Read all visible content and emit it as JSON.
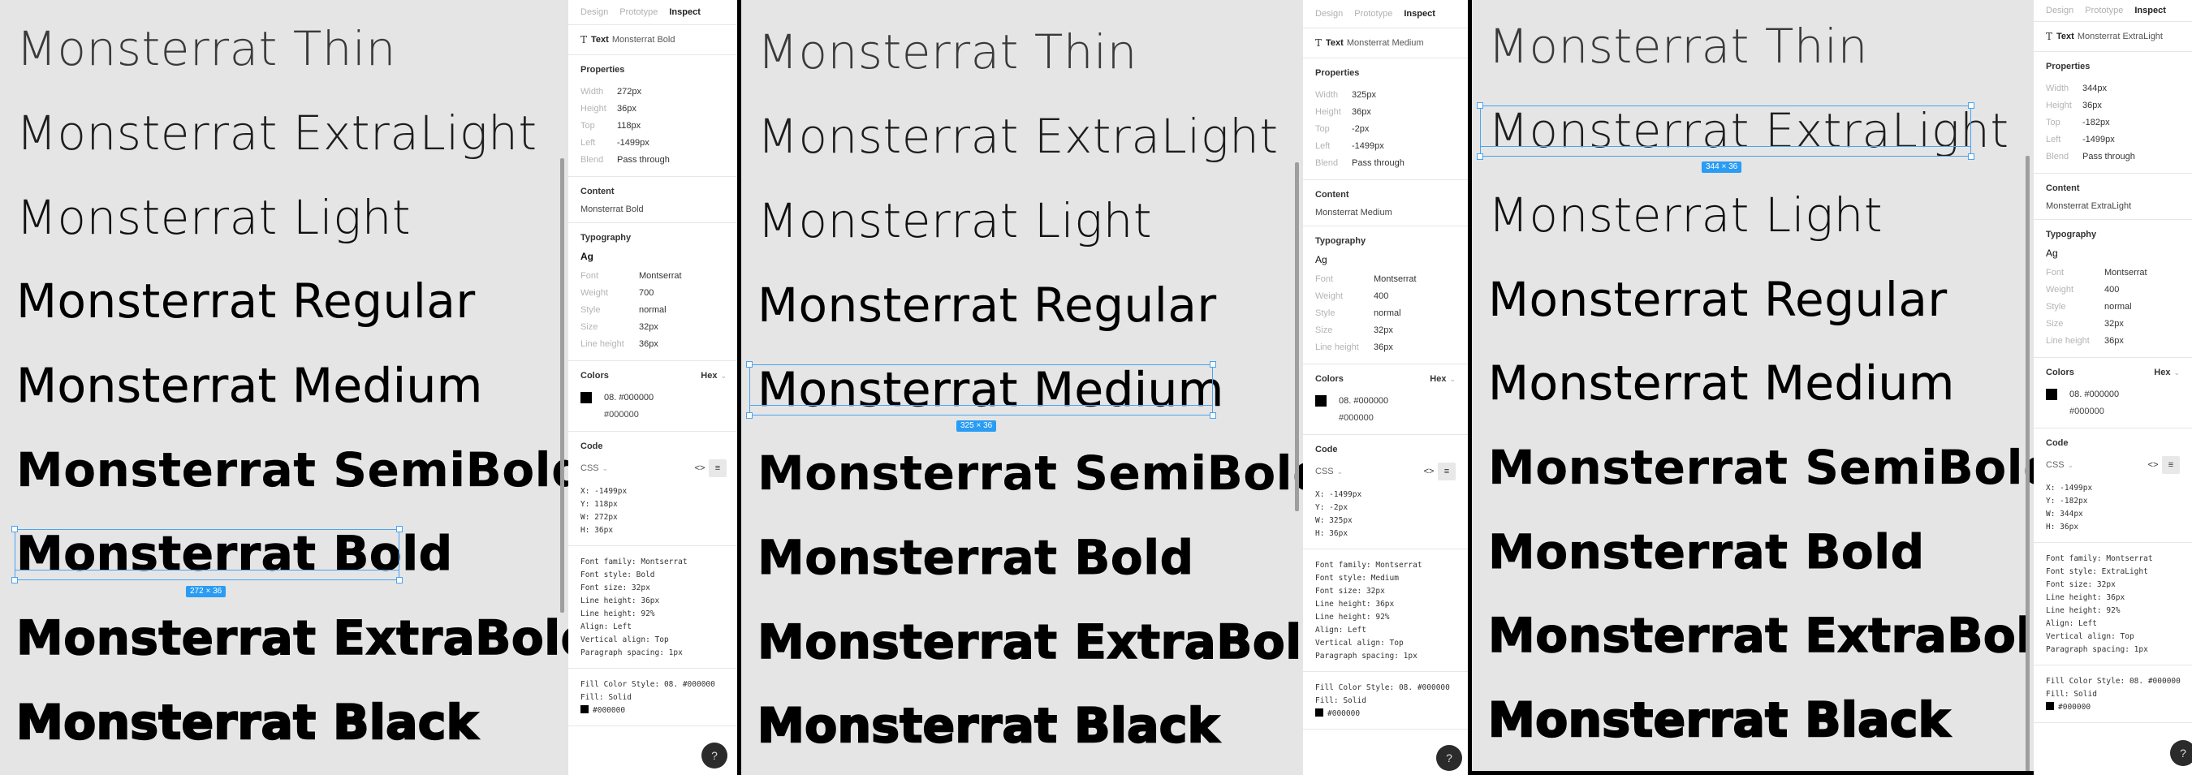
{
  "samples": [
    "Monsterrat Thin",
    "Monsterrat ExtraLight",
    "Monsterrat Light",
    "Monsterrat Regular",
    "Monsterrat Medium",
    "Monsterrat SemiBold",
    "Monsterrat Bold",
    "Monsterrat ExtraBold",
    "Monsterrat Black"
  ],
  "colors": {
    "selection": "#4aa3f0",
    "badge": "#2a9cf4",
    "canvas": "#e5e5e5",
    "text_fill": "#000000"
  },
  "panels": [
    {
      "tabs": [
        "Design",
        "Prototype",
        "Inspect"
      ],
      "active_tab": "Inspect",
      "layer": {
        "kind": "Text",
        "name": "Monsterrat Bold",
        "icon": "text-tool-icon"
      },
      "selection_badge": "272 × 36",
      "properties": {
        "title": "Properties",
        "rows": [
          {
            "label": "Width",
            "value": "272px"
          },
          {
            "label": "Height",
            "value": "36px"
          },
          {
            "label": "Top",
            "value": "118px"
          },
          {
            "label": "Left",
            "value": "-1499px"
          },
          {
            "label": "Blend",
            "value": "Pass through"
          }
        ]
      },
      "content": {
        "title": "Content",
        "value": "Monsterrat Bold"
      },
      "typography": {
        "title": "Typography",
        "sample": "Ag",
        "rows": [
          {
            "label": "Font",
            "value": "Montserrat"
          },
          {
            "label": "Weight",
            "value": "700"
          },
          {
            "label": "Style",
            "value": "normal"
          },
          {
            "label": "Size",
            "value": "32px"
          },
          {
            "label": "Line height",
            "value": "36px"
          }
        ]
      },
      "colors": {
        "title": "Colors",
        "format": "Hex",
        "style_name": "08. #000000",
        "hex": "#000000"
      },
      "code": {
        "title": "Code",
        "lang": "CSS",
        "position": "X: -1499px\nY: 118px\nW: 272px\nH: 36px",
        "font": "Font family: Montserrat\nFont style: Bold\nFont size: 32px\nLine height: 36px\nLine height: 92%\nAlign: Left\nVertical align: Top\nParagraph spacing: 1px",
        "fill_style": "Fill Color Style: 08. #000000\nFill: Solid",
        "fill_hex": "#000000"
      },
      "help": "?"
    },
    {
      "tabs": [
        "Design",
        "Prototype",
        "Inspect"
      ],
      "active_tab": "Inspect",
      "layer": {
        "kind": "Text",
        "name": "Monsterrat Medium",
        "icon": "text-tool-icon"
      },
      "selection_badge": "325 × 36",
      "properties": {
        "title": "Properties",
        "rows": [
          {
            "label": "Width",
            "value": "325px"
          },
          {
            "label": "Height",
            "value": "36px"
          },
          {
            "label": "Top",
            "value": "-2px"
          },
          {
            "label": "Left",
            "value": "-1499px"
          },
          {
            "label": "Blend",
            "value": "Pass through"
          }
        ]
      },
      "content": {
        "title": "Content",
        "value": "Monsterrat Medium"
      },
      "typography": {
        "title": "Typography",
        "sample": "Ag",
        "rows": [
          {
            "label": "Font",
            "value": "Montserrat"
          },
          {
            "label": "Weight",
            "value": "400"
          },
          {
            "label": "Style",
            "value": "normal"
          },
          {
            "label": "Size",
            "value": "32px"
          },
          {
            "label": "Line height",
            "value": "36px"
          }
        ]
      },
      "colors": {
        "title": "Colors",
        "format": "Hex",
        "style_name": "08. #000000",
        "hex": "#000000"
      },
      "code": {
        "title": "Code",
        "lang": "CSS",
        "position": "X: -1499px\nY: -2px\nW: 325px\nH: 36px",
        "font": "Font family: Montserrat\nFont style: Medium\nFont size: 32px\nLine height: 36px\nLine height: 92%\nAlign: Left\nVertical align: Top\nParagraph spacing: 1px",
        "fill_style": "Fill Color Style: 08. #000000\nFill: Solid",
        "fill_hex": "#000000"
      },
      "help": "?"
    },
    {
      "tabs": [
        "Design",
        "Prototype",
        "Inspect"
      ],
      "active_tab": "Inspect",
      "layer": {
        "kind": "Text",
        "name": "Monsterrat ExtraLight",
        "icon": "text-tool-icon"
      },
      "selection_badge": "344 × 36",
      "properties": {
        "title": "Properties",
        "rows": [
          {
            "label": "Width",
            "value": "344px"
          },
          {
            "label": "Height",
            "value": "36px"
          },
          {
            "label": "Top",
            "value": "-182px"
          },
          {
            "label": "Left",
            "value": "-1499px"
          },
          {
            "label": "Blend",
            "value": "Pass through"
          }
        ]
      },
      "content": {
        "title": "Content",
        "value": "Monsterrat ExtraLight"
      },
      "typography": {
        "title": "Typography",
        "sample": "Ag",
        "rows": [
          {
            "label": "Font",
            "value": "Montserrat"
          },
          {
            "label": "Weight",
            "value": "400"
          },
          {
            "label": "Style",
            "value": "normal"
          },
          {
            "label": "Size",
            "value": "32px"
          },
          {
            "label": "Line height",
            "value": "36px"
          }
        ]
      },
      "colors": {
        "title": "Colors",
        "format": "Hex",
        "style_name": "08. #000000",
        "hex": "#000000"
      },
      "code": {
        "title": "Code",
        "lang": "CSS",
        "position": "X: -1499px\nY: -182px\nW: 344px\nH: 36px",
        "font": "Font family: Montserrat\nFont style: ExtraLight\nFont size: 32px\nLine height: 36px\nLine height: 92%\nAlign: Left\nVertical align: Top\nParagraph spacing: 1px",
        "fill_style": "Fill Color Style: 08. #000000\nFill: Solid",
        "fill_hex": "#000000"
      },
      "help": "?"
    }
  ]
}
